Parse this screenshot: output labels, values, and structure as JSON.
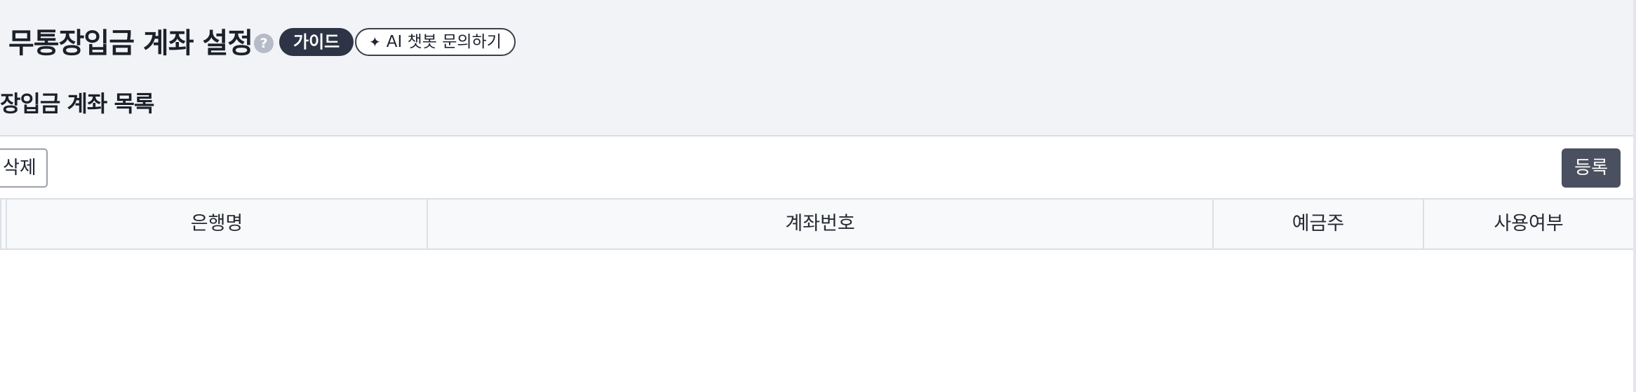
{
  "header": {
    "title": "무통장입금 계좌 설정",
    "help_icon": "question-icon",
    "guide_label": "가이드",
    "ai_button_label": "AI 챗봇 문의하기",
    "ai_icon": "sparkle-icon"
  },
  "section": {
    "title": "장입금 계좌 목록"
  },
  "toolbar": {
    "delete_label": "삭제",
    "register_label": "등록"
  },
  "table": {
    "columns": [
      "은행명",
      "계좌번호",
      "예금주",
      "사용여부"
    ],
    "rows": []
  },
  "colors": {
    "header_bg": "#f1f3f7",
    "badge_bg": "#2d3445",
    "register_bg": "#4a5060"
  }
}
